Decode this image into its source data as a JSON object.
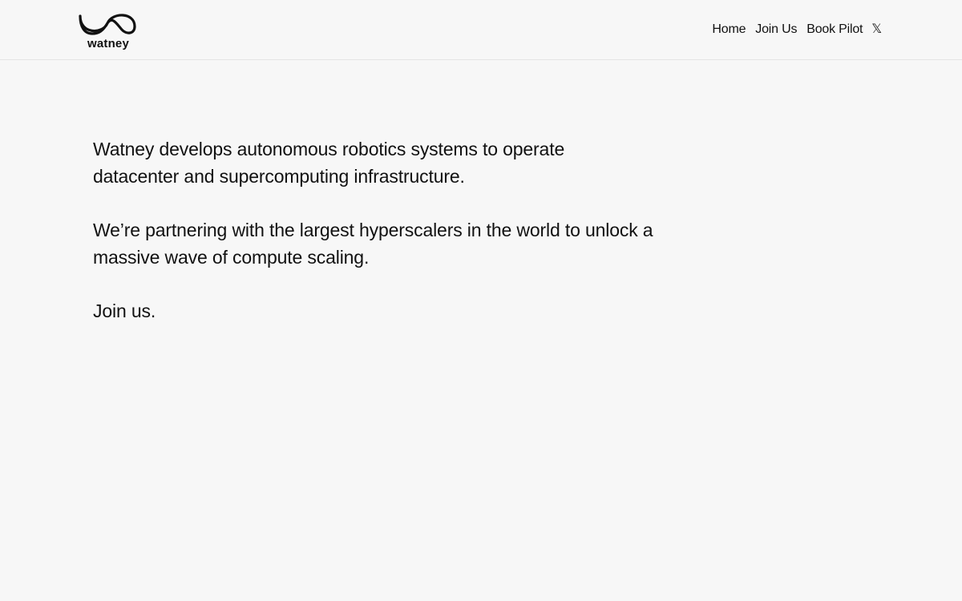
{
  "brand": {
    "wordmark": "watney",
    "logo_icon": "wave-infinity-logo-icon"
  },
  "nav": {
    "items": [
      {
        "label": "Home"
      },
      {
        "label": "Join Us"
      },
      {
        "label": "Book Pilot"
      },
      {
        "label": "𝕏",
        "icon": "x-logo-icon"
      }
    ]
  },
  "main": {
    "paragraphs": [
      "Watney develops autonomous robotics systems to operate datacenter and supercomputing infrastructure.",
      "We’re partnering with the largest hyperscalers in the world to unlock a massive wave of compute scaling.",
      "Join us."
    ]
  },
  "colors": {
    "background": "#f7f7f7",
    "text": "#111111",
    "divider": "#e4e4e4"
  }
}
